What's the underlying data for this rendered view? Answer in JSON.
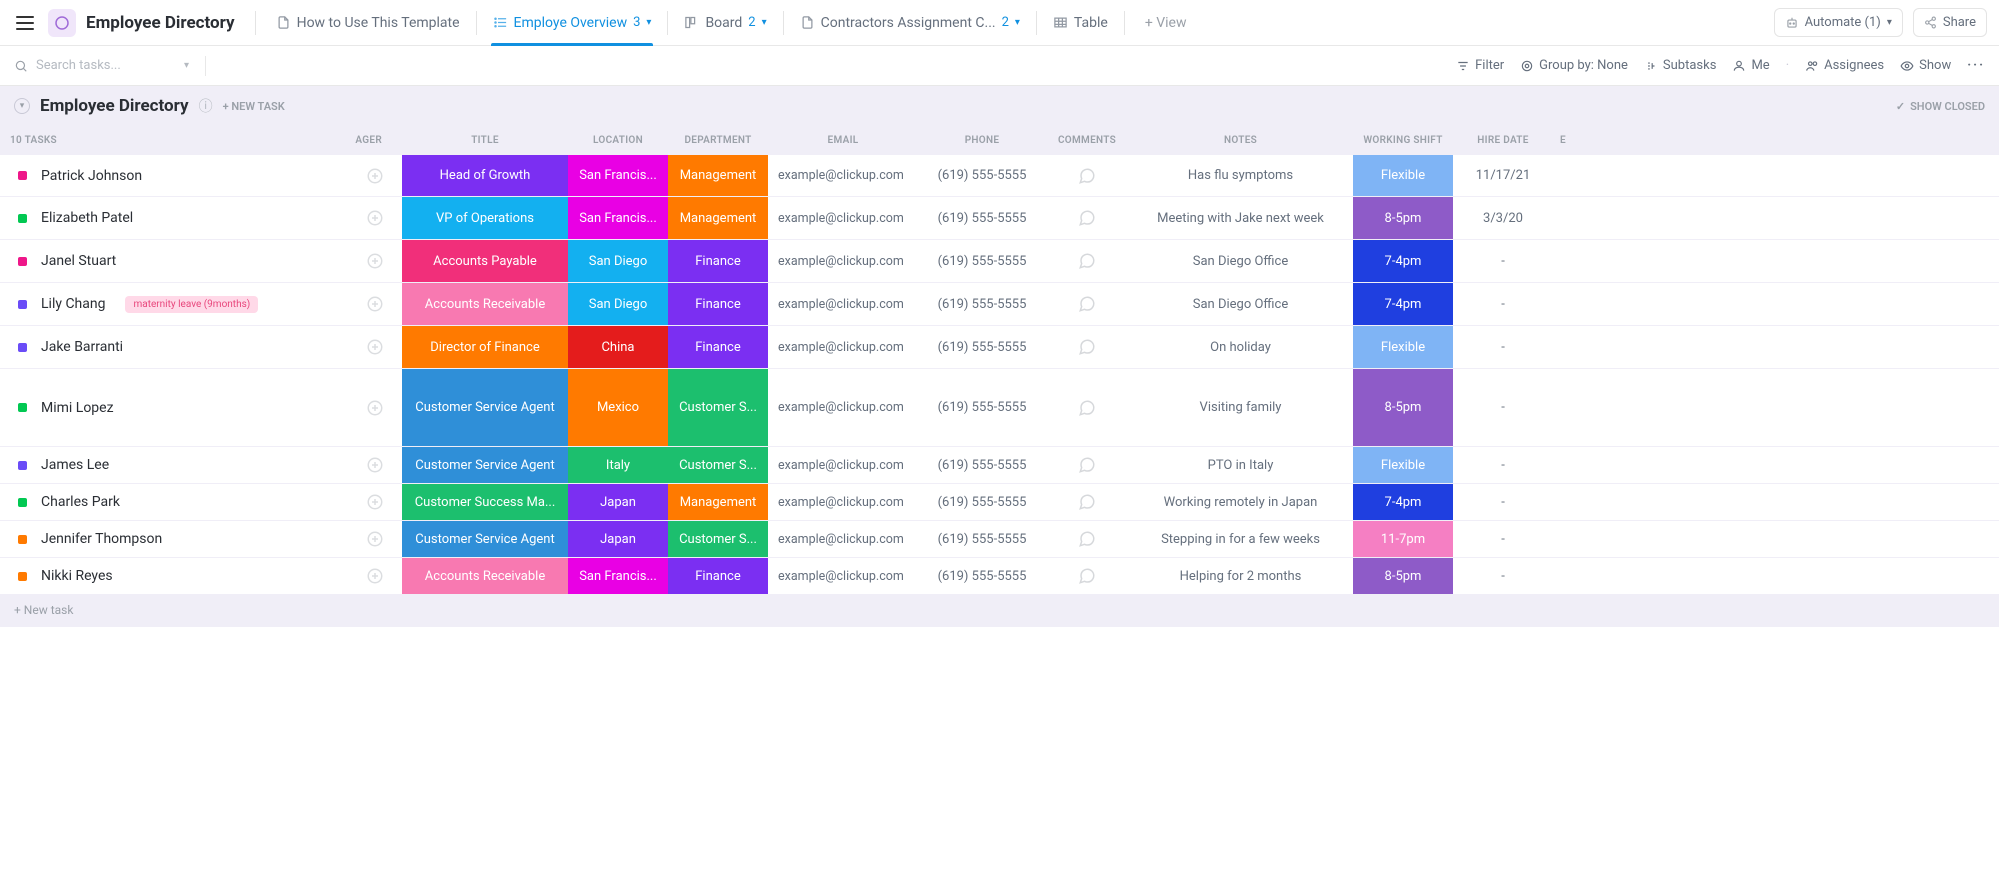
{
  "header": {
    "workspace_title": "Employee Directory",
    "tabs": [
      {
        "label": "How to Use This Template",
        "icon": "doc",
        "count": "",
        "active": false
      },
      {
        "label": "Employe Overview",
        "icon": "list",
        "count": "3",
        "active": true
      },
      {
        "label": "Board",
        "icon": "board",
        "count": "2",
        "active": false
      },
      {
        "label": "Contractors Assignment C...",
        "icon": "doc",
        "count": "2",
        "active": false
      },
      {
        "label": "Table",
        "icon": "table",
        "count": "",
        "active": false
      }
    ],
    "add_view": "+ View",
    "automate_label": "Automate (1)",
    "share_label": "Share"
  },
  "toolbar": {
    "search_placeholder": "Search tasks...",
    "filter_label": "Filter",
    "groupby_label": "Group by: None",
    "subtasks_label": "Subtasks",
    "me_label": "Me",
    "assignees_label": "Assignees",
    "show_label": "Show"
  },
  "list": {
    "title": "Employee Directory",
    "new_task_label": "+ NEW TASK",
    "show_closed_label": "SHOW CLOSED",
    "task_count_label": "10 TASKS",
    "columns": {
      "manager": "AGER",
      "title": "TITLE",
      "location": "LOCATION",
      "department": "DEPARTMENT",
      "email": "EMAIL",
      "phone": "PHONE",
      "comments": "COMMENTS",
      "notes": "NOTES",
      "shift": "WORKING SHIFT",
      "hire": "HIRE DATE",
      "extra": "E"
    },
    "rows": [
      {
        "status": "#ee1789",
        "name": "Patrick Johnson",
        "tag": "",
        "title": "Head of Growth",
        "title_c": "#7b2ff2",
        "loc": "San Francis...",
        "loc_c": "#e900e4",
        "dept": "Management",
        "dept_c": "#ff7a00",
        "email": "example@clickup.com",
        "phone": "(619) 555-5555",
        "notes": "Has flu symptoms",
        "shift": "Flexible",
        "shift_c": "#7fb4f5",
        "hire": "11/17/21",
        "h": "norm"
      },
      {
        "status": "#02c852",
        "name": "Elizabeth Patel",
        "tag": "",
        "title": "VP of Operations",
        "title_c": "#13b0f0",
        "loc": "San Francis...",
        "loc_c": "#e900e4",
        "dept": "Management",
        "dept_c": "#ff7a00",
        "email": "example@clickup.com",
        "phone": "(619) 555-5555",
        "notes": "Meeting with Jake next week",
        "shift": "8-5pm",
        "shift_c": "#8e5bc8",
        "hire": "3/3/20",
        "h": "norm"
      },
      {
        "status": "#ee1789",
        "name": "Janel Stuart",
        "tag": "",
        "title": "Accounts Payable",
        "title_c": "#f12f7a",
        "loc": "San Diego",
        "loc_c": "#13b0f0",
        "dept": "Finance",
        "dept_c": "#7b2ff2",
        "email": "example@clickup.com",
        "phone": "(619) 555-5555",
        "notes": "San Diego Office",
        "shift": "7-4pm",
        "shift_c": "#1f3fe0",
        "hire": "-",
        "h": "norm"
      },
      {
        "status": "#6a4cf7",
        "name": "Lily Chang",
        "tag": "maternity leave (9months)",
        "title": "Accounts Receivable",
        "title_c": "#f879b1",
        "loc": "San Diego",
        "loc_c": "#13b0f0",
        "dept": "Finance",
        "dept_c": "#7b2ff2",
        "email": "example@clickup.com",
        "phone": "(619) 555-5555",
        "notes": "San Diego Office",
        "shift": "7-4pm",
        "shift_c": "#1f3fe0",
        "hire": "-",
        "h": "norm"
      },
      {
        "status": "#6a4cf7",
        "name": "Jake Barranti",
        "tag": "",
        "title": "Director of Finance",
        "title_c": "#ff7a00",
        "loc": "China",
        "loc_c": "#e41c1c",
        "dept": "Finance",
        "dept_c": "#7b2ff2",
        "email": "example@clickup.com",
        "phone": "(619) 555-5555",
        "notes": "On holiday",
        "shift": "Flexible",
        "shift_c": "#7fb4f5",
        "hire": "-",
        "h": "norm"
      },
      {
        "status": "#02c852",
        "name": "Mimi Lopez",
        "tag": "",
        "title": "Customer Service Agent",
        "title_c": "#2f8fd8",
        "loc": "Mexico",
        "loc_c": "#ff7a00",
        "dept": "Customer S...",
        "dept_c": "#1cbf6e",
        "email": "example@clickup.com",
        "phone": "(619) 555-5555",
        "notes": "Visiting family",
        "shift": "8-5pm",
        "shift_c": "#8e5bc8",
        "hire": "-",
        "h": "tall"
      },
      {
        "status": "#6a4cf7",
        "name": "James Lee",
        "tag": "",
        "title": "Customer Service Agent",
        "title_c": "#2f8fd8",
        "loc": "Italy",
        "loc_c": "#1cbf6e",
        "dept": "Customer S...",
        "dept_c": "#1cbf6e",
        "email": "example@clickup.com",
        "phone": "(619) 555-5555",
        "notes": "PTO in Italy",
        "shift": "Flexible",
        "shift_c": "#7fb4f5",
        "hire": "-",
        "h": "short"
      },
      {
        "status": "#02c852",
        "name": "Charles Park",
        "tag": "",
        "title": "Customer Success Ma...",
        "title_c": "#1cbf6e",
        "loc": "Japan",
        "loc_c": "#7b2ff2",
        "dept": "Management",
        "dept_c": "#ff7a00",
        "email": "example@clickup.com",
        "phone": "(619) 555-5555",
        "notes": "Working remotely in Japan",
        "shift": "7-4pm",
        "shift_c": "#1f3fe0",
        "hire": "-",
        "h": "short"
      },
      {
        "status": "#ff7a00",
        "name": "Jennifer Thompson",
        "tag": "",
        "title": "Customer Service Agent",
        "title_c": "#2f8fd8",
        "loc": "Japan",
        "loc_c": "#7b2ff2",
        "dept": "Customer S...",
        "dept_c": "#1cbf6e",
        "email": "example@clickup.com",
        "phone": "(619) 555-5555",
        "notes": "Stepping in for a few weeks",
        "shift": "11-7pm",
        "shift_c": "#f57fc3",
        "hire": "-",
        "h": "short"
      },
      {
        "status": "#ff7a00",
        "name": "Nikki Reyes",
        "tag": "",
        "title": "Accounts Receivable",
        "title_c": "#f879b1",
        "loc": "San Francis...",
        "loc_c": "#e900e4",
        "dept": "Finance",
        "dept_c": "#7b2ff2",
        "email": "example@clickup.com",
        "phone": "(619) 555-5555",
        "notes": "Helping for 2 months",
        "shift": "8-5pm",
        "shift_c": "#8e5bc8",
        "hire": "-",
        "h": "short"
      }
    ],
    "new_task_row": "+ New task"
  }
}
